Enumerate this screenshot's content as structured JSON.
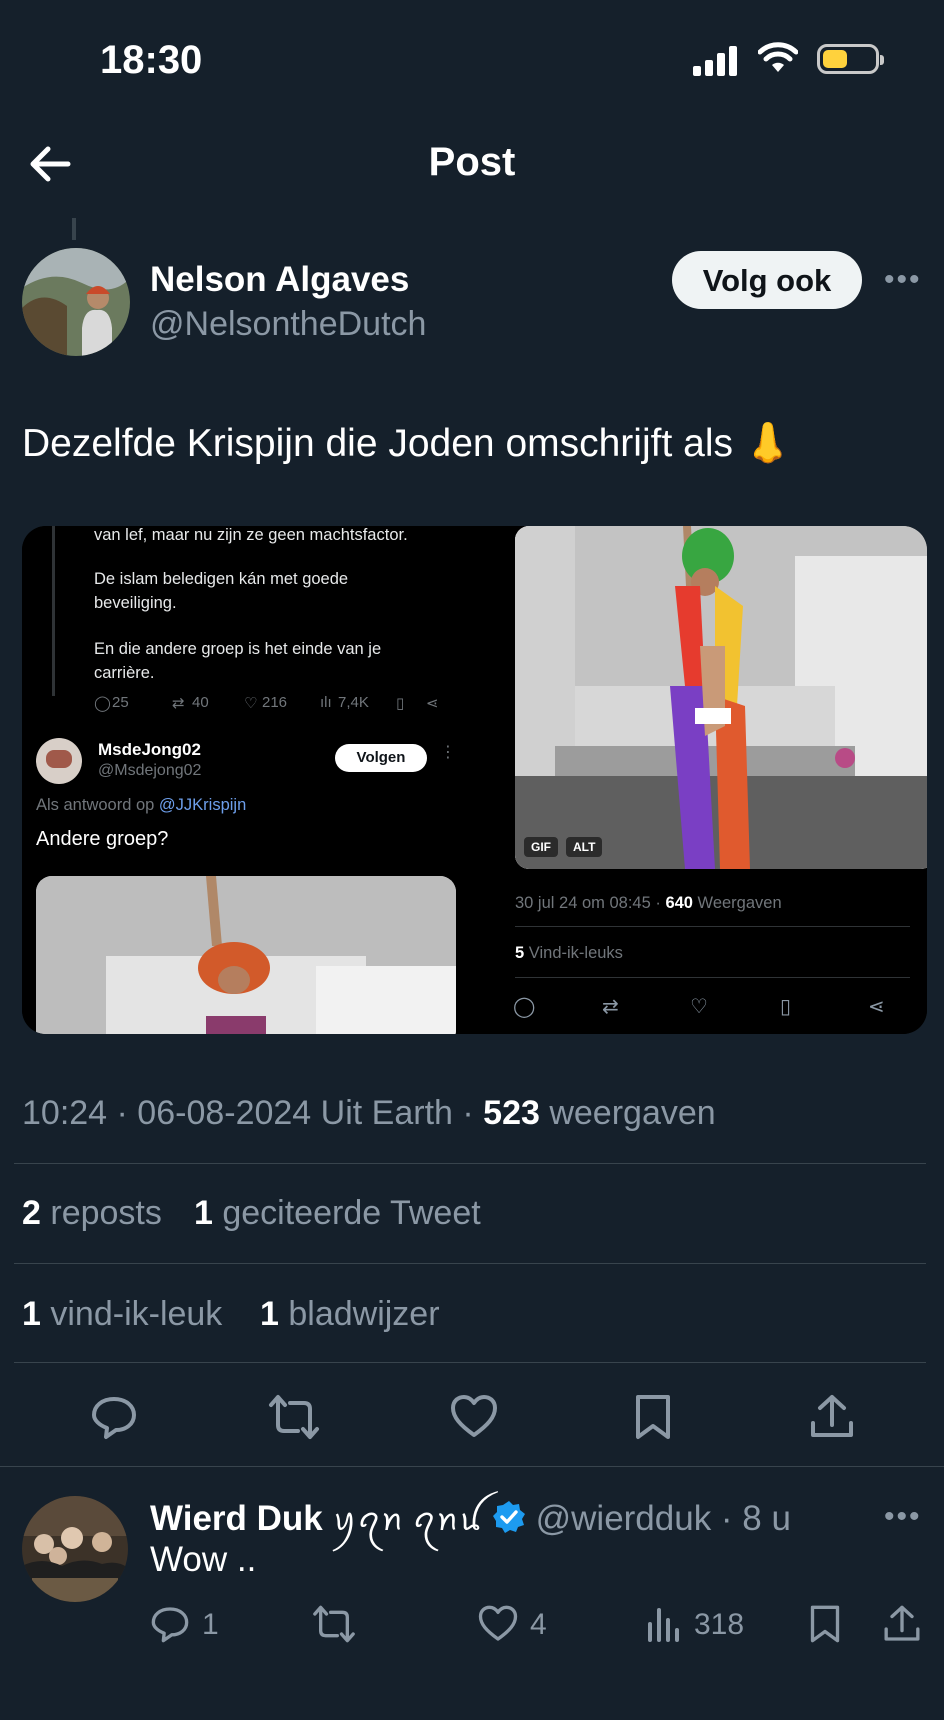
{
  "status_bar": {
    "time": "18:30"
  },
  "nav": {
    "title": "Post"
  },
  "post": {
    "author_name": "Nelson Algaves",
    "author_handle": "@NelsontheDutch",
    "follow_label": "Volg ook",
    "text": "Dezelfde Krispijn die Joden omschrijft als 👃",
    "meta_time_date": "10:24 · 06-08-2024 Uit Earth · ",
    "meta_views": "523",
    "meta_views_label": " weergaven",
    "reposts_count": "2",
    "reposts_label": " reposts",
    "quotes_count": "1",
    "quotes_label": " geciteerde Tweet",
    "likes_count": "1",
    "likes_label": " vind-ik-leuk",
    "bookmarks_count": "1",
    "bookmarks_label": " bladwijzer"
  },
  "media_left": {
    "line1": "van lef, maar nu zijn ze geen machtsfactor.",
    "line2": "De islam beledigen kán met goede",
    "line3": "beveiliging.",
    "line4": "En die andere groep is het einde van je",
    "line5": "carrière.",
    "stat_replies": "25",
    "stat_reposts": "40",
    "stat_likes": "216",
    "stat_views": "7,4K",
    "reply_name": "MsdeJong02",
    "reply_handle": "@Msdejong02",
    "follow_label": "Volgen",
    "reply_to_prefix": "Als antwoord op ",
    "reply_to_handle": "@JJKrispijn",
    "reply_text": "Andere groep?"
  },
  "media_right": {
    "gif_badge": "GIF",
    "alt_badge": "ALT",
    "date_line": "30 jul 24 om 08:45 · ",
    "views_count": "640",
    "views_label": " Weergaven",
    "likes_count": "5",
    "likes_label": " Vind-ik-leuks"
  },
  "reply": {
    "name": "Wierd Duk",
    "name_extra": "ꪗꪖꪀ ꪖꪀꪊ",
    "handle_time": "@wierdduk · 8 u",
    "text": "Wow ..",
    "reply_count": "1",
    "like_count": "4",
    "view_count": "318"
  },
  "colors": {
    "background": "#15202b",
    "text": "#e7e9ea",
    "muted": "#8b98a5",
    "verified": "#1d9bf0"
  }
}
